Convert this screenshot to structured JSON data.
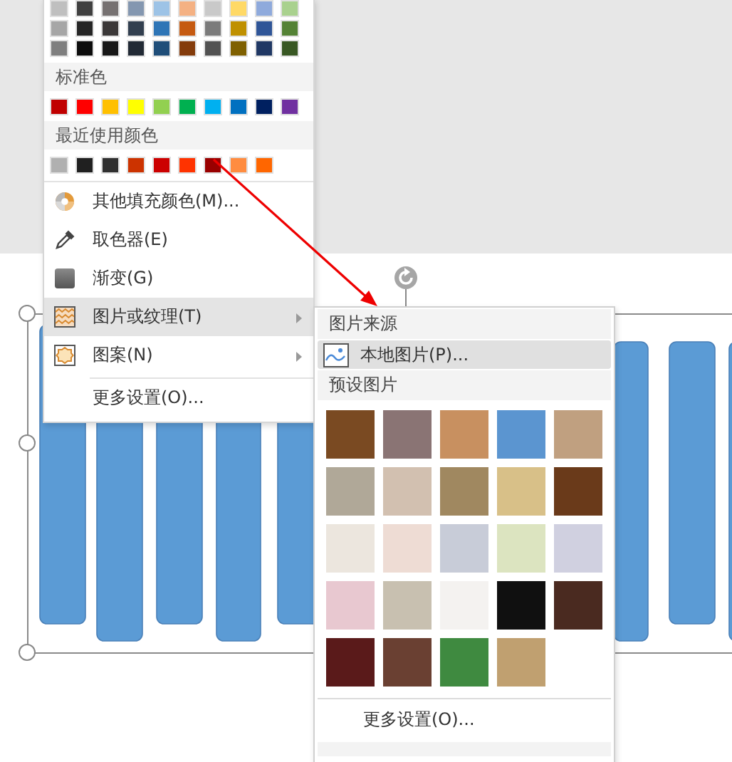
{
  "fill_menu": {
    "theme_colors": [
      [
        {
          "color": "#bfbfbf"
        },
        {
          "color": "#404040"
        },
        {
          "color": "#767171"
        },
        {
          "color": "#8497b0"
        },
        {
          "color": "#9dc3e6"
        },
        {
          "color": "#f4b183"
        },
        {
          "color": "#c9c9c9"
        },
        {
          "color": "#ffd966"
        },
        {
          "color": "#8faadc"
        },
        {
          "color": "#a9d18e"
        }
      ],
      [
        {
          "color": "#a6a6a6"
        },
        {
          "color": "#262626"
        },
        {
          "color": "#3b3838"
        },
        {
          "color": "#323f4f"
        },
        {
          "color": "#2e75b6"
        },
        {
          "color": "#c55a11"
        },
        {
          "color": "#7b7b7b"
        },
        {
          "color": "#bf9000"
        },
        {
          "color": "#2f5597"
        },
        {
          "color": "#548235"
        }
      ],
      [
        {
          "color": "#7f7f7f"
        },
        {
          "color": "#0d0d0d"
        },
        {
          "color": "#171717"
        },
        {
          "color": "#222a35"
        },
        {
          "color": "#1f4e79"
        },
        {
          "color": "#843c0c"
        },
        {
          "color": "#525252"
        },
        {
          "color": "#7f6000"
        },
        {
          "color": "#203864"
        },
        {
          "color": "#385723"
        }
      ]
    ],
    "standard_title": "标准色",
    "standard_colors": [
      {
        "color": "#c00000"
      },
      {
        "color": "#ff0000"
      },
      {
        "color": "#ffc000"
      },
      {
        "color": "#ffff00"
      },
      {
        "color": "#92d050"
      },
      {
        "color": "#00b050"
      },
      {
        "color": "#00b0f0"
      },
      {
        "color": "#0070c0"
      },
      {
        "color": "#002060"
      },
      {
        "color": "#7030a0"
      }
    ],
    "recent_title": "最近使用颜色",
    "recent_colors": [
      {
        "color": "#b0b0b0"
      },
      {
        "color": "#202020"
      },
      {
        "color": "#303030"
      },
      {
        "color": "#cc3300"
      },
      {
        "color": "#cc0000"
      },
      {
        "color": "#ff3300"
      },
      {
        "color": "#990000"
      },
      {
        "color": "#ff8c40"
      },
      {
        "color": "#ff6600"
      }
    ],
    "items": [
      {
        "kind": "palette",
        "label": "其他填充颜色(M)...",
        "selected": false,
        "submenu": false
      },
      {
        "kind": "eyedropper",
        "label": "取色器(E)",
        "selected": false,
        "submenu": false
      },
      {
        "kind": "gradient",
        "label": "渐变(G)",
        "selected": false,
        "submenu": false
      },
      {
        "kind": "texture",
        "label": "图片或纹理(T)",
        "selected": true,
        "submenu": true
      },
      {
        "kind": "pattern",
        "label": "图案(N)",
        "selected": false,
        "submenu": true
      }
    ],
    "footer_items": [
      {
        "label": "更多设置(O)...",
        "selected": false
      }
    ]
  },
  "texture_submenu": {
    "source_title": "图片来源",
    "source_items": [
      {
        "kind": "picture",
        "label": "本地图片(P)...",
        "selected": true
      }
    ],
    "preset_title": "预设图片",
    "textures": [
      {
        "color": "#7a4a22"
      },
      {
        "color": "#8a7474"
      },
      {
        "color": "#c89060"
      },
      {
        "color": "#5b95d0"
      },
      {
        "color": "#c0a080"
      },
      {
        "color": "#b0a898"
      },
      {
        "color": "#d2c0b0"
      },
      {
        "color": "#a08860"
      },
      {
        "color": "#d8c088"
      },
      {
        "color": "#6a3a1a"
      },
      {
        "color": "#ece6de"
      },
      {
        "color": "#eedcd4"
      },
      {
        "color": "#c8ccd8"
      },
      {
        "color": "#dce4c0"
      },
      {
        "color": "#d0d0e0"
      },
      {
        "color": "#e8c8d0"
      },
      {
        "color": "#c8c0b0"
      },
      {
        "color": "#f4f2f0"
      },
      {
        "color": "#101010"
      },
      {
        "color": "#4a2a20"
      },
      {
        "color": "#5a1a1a"
      },
      {
        "color": "#6a4032"
      },
      {
        "color": "#3f8a40"
      },
      {
        "color": "#c0a070"
      }
    ],
    "footer_items": [
      {
        "label": "更多设置(O)...",
        "selected": false
      }
    ]
  }
}
